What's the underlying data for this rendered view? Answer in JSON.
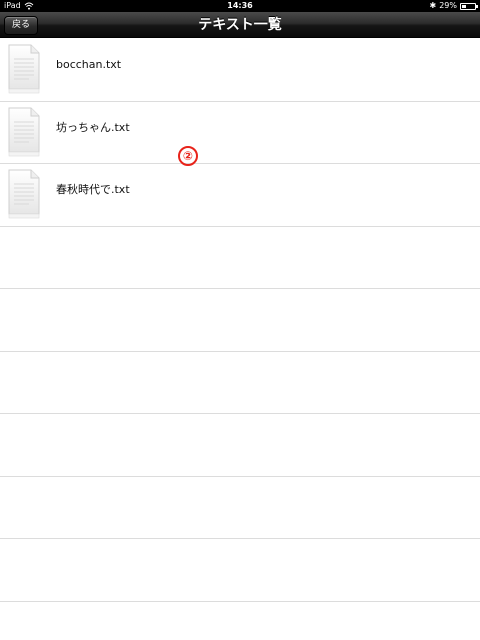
{
  "status_bar": {
    "device": "iPad",
    "time": "14:36",
    "battery_text": "29%",
    "battery_level": 0.29
  },
  "nav_bar": {
    "back_label": "戻る",
    "title": "テキスト一覧"
  },
  "files": [
    {
      "name": "bocchan.txt",
      "icon": "text-file-icon"
    },
    {
      "name": "坊っちゃん.txt",
      "icon": "text-file-icon"
    },
    {
      "name": "春秋時代で.txt",
      "icon": "text-file-icon"
    }
  ],
  "empty_rows": 7,
  "annotation": {
    "label": "②",
    "color": "#e8231a"
  }
}
